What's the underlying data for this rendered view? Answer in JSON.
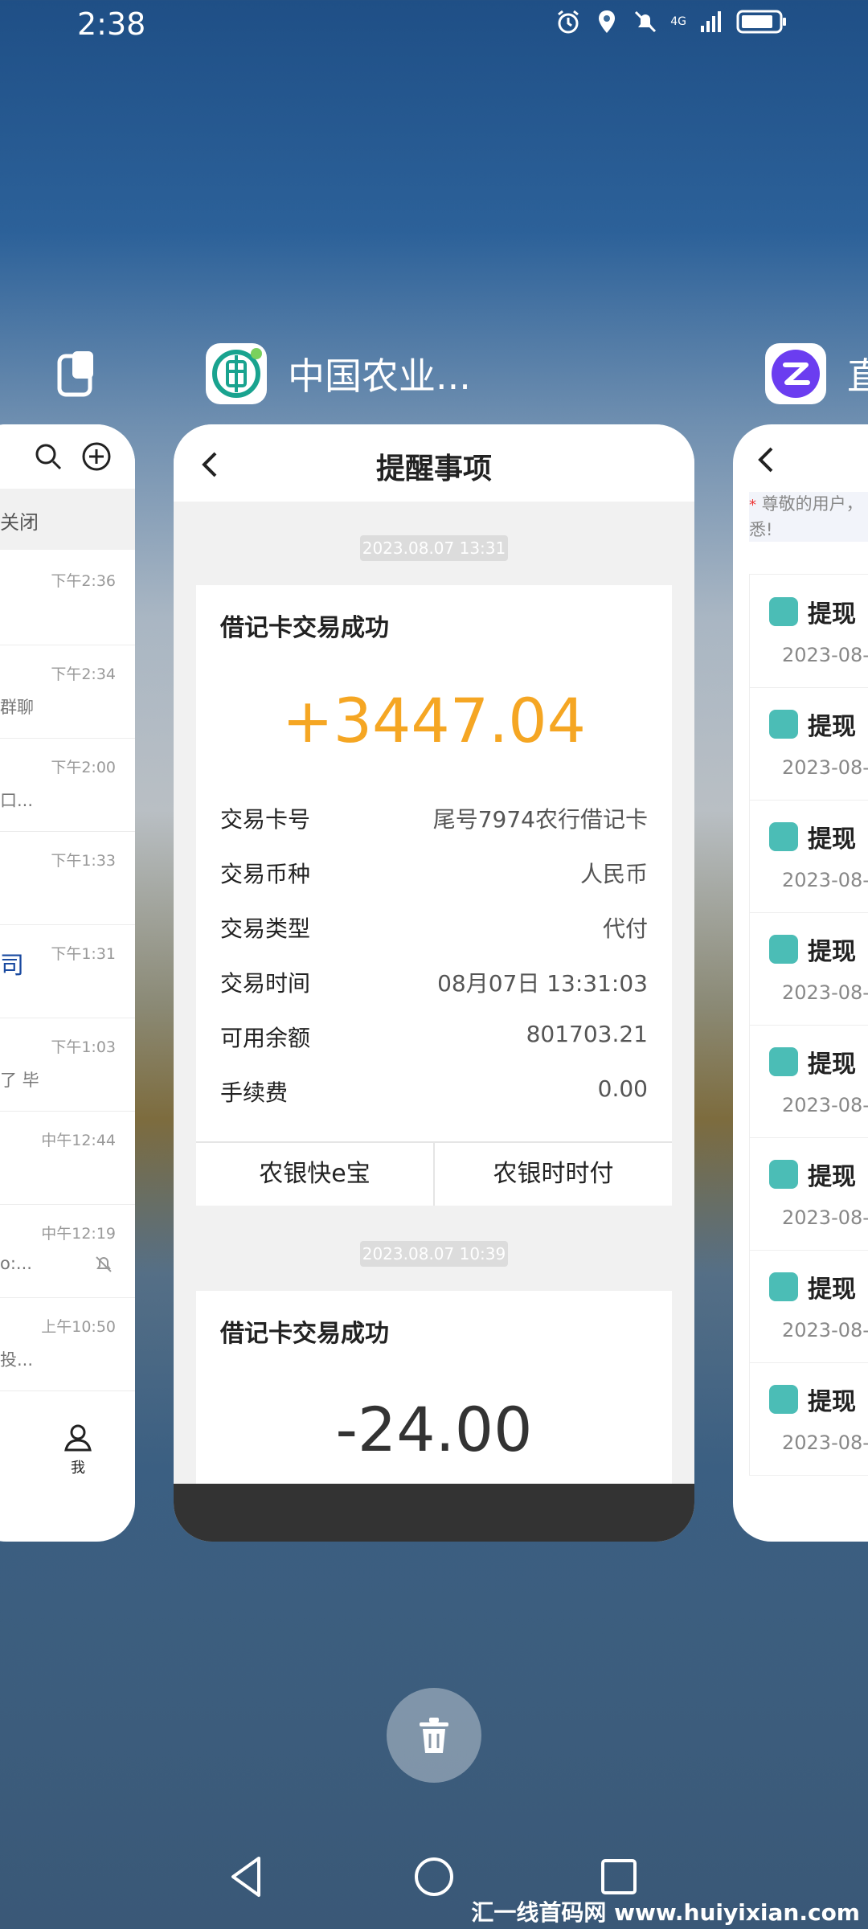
{
  "status_bar": {
    "time": "2:38",
    "network": "4G"
  },
  "apps": {
    "left_icon_name": "multiwindow-icon",
    "center_app_name": "中国农业...",
    "right_app_partial_name": "直"
  },
  "left_card": {
    "close_label": "关闭",
    "items": [
      {
        "time": "下午2:36",
        "snippet": ""
      },
      {
        "time": "下午2:34",
        "snippet": "群聊"
      },
      {
        "time": "下午2:00",
        "snippet": "口..."
      },
      {
        "time": "下午1:33",
        "snippet": ""
      },
      {
        "time": "下午1:31",
        "snippet": "司"
      },
      {
        "time": "下午1:03",
        "snippet": "了 毕"
      },
      {
        "time": "中午12:44",
        "snippet": ""
      },
      {
        "time": "中午12:19",
        "snippet": "o:..."
      },
      {
        "time": "上午10:50",
        "snippet": "投..."
      }
    ],
    "me_label": "我"
  },
  "main_card": {
    "title": "提醒事项",
    "messages": [
      {
        "timestamp": "2023.08.07 13:31",
        "title": "借记卡交易成功",
        "amount": "+3447.04",
        "rows": [
          {
            "k": "交易卡号",
            "v": "尾号7974农行借记卡"
          },
          {
            "k": "交易币种",
            "v": "人民币"
          },
          {
            "k": "交易类型",
            "v": "代付"
          },
          {
            "k": "交易时间",
            "v": "08月07日 13:31:03"
          },
          {
            "k": "可用余额",
            "v": "801703.21"
          },
          {
            "k": "手续费",
            "v": "0.00"
          }
        ],
        "buttons": [
          "农银快e宝",
          "农银时时付"
        ]
      },
      {
        "timestamp": "2023.08.07 10:39",
        "title": "借记卡交易成功",
        "amount": "-24.00"
      }
    ],
    "colors": {
      "positive": "#f5a623",
      "negative": "#333333"
    }
  },
  "right_card": {
    "notice": "尊敬的用户，\n悉!",
    "items": [
      {
        "label": "提现",
        "date": "2023-08-"
      },
      {
        "label": "提现",
        "date": "2023-08-"
      },
      {
        "label": "提现",
        "date": "2023-08-"
      },
      {
        "label": "提现",
        "date": "2023-08-"
      },
      {
        "label": "提现",
        "date": "2023-08-"
      },
      {
        "label": "提现",
        "date": "2023-08-"
      },
      {
        "label": "提现",
        "date": "2023-08-"
      },
      {
        "label": "提现",
        "date": "2023-08-"
      }
    ]
  },
  "watermark": "汇一线首码网 www.huiyixian.com"
}
